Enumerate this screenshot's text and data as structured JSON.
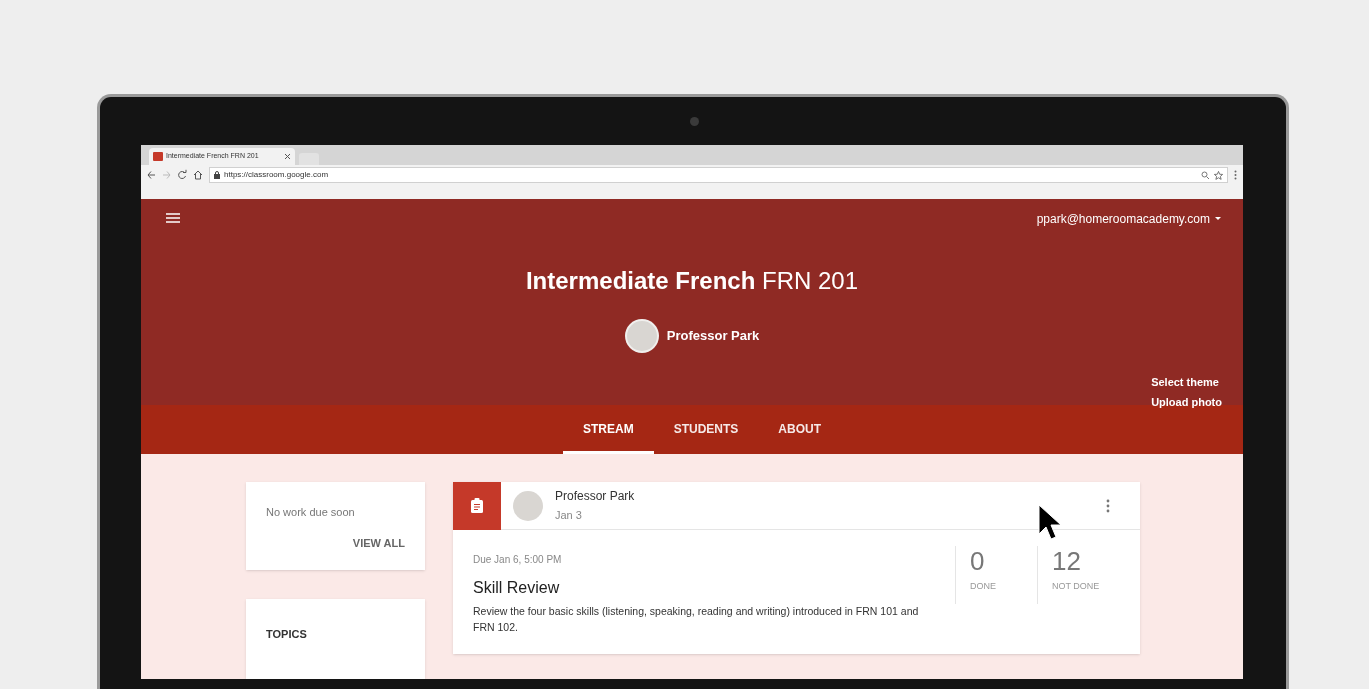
{
  "browser": {
    "tab_title": "Intermediate French FRN 201",
    "url": "https://classroom.google.com"
  },
  "header": {
    "account": "ppark@homeroomacademy.com",
    "title": "**Intermediate French** FRN 201",
    "teacher": "Professor Park",
    "links": [
      "Select theme",
      "Upload photo"
    ]
  },
  "tabs": [
    {
      "label": "STREAM",
      "selected": true
    },
    {
      "label": "STUDENTS",
      "selected": false
    },
    {
      "label": "ABOUT",
      "selected": false
    }
  ],
  "upcoming": {
    "message": "No work due soon",
    "link": "VIEW ALL"
  },
  "topics": {
    "heading": "TOPICS"
  },
  "post": {
    "author": "Professor Park",
    "date": "Jan 3",
    "due": "Due Jan 6, 5:00 PM",
    "title": "Skill Review",
    "description": "Review the four basic skills (listening, speaking, reading and writing) introduced in FRN 101 and FRN 102.",
    "stats": [
      {
        "value": "0",
        "label": "DONE"
      },
      {
        "value": "12",
        "label": "NOT DONE"
      }
    ]
  }
}
